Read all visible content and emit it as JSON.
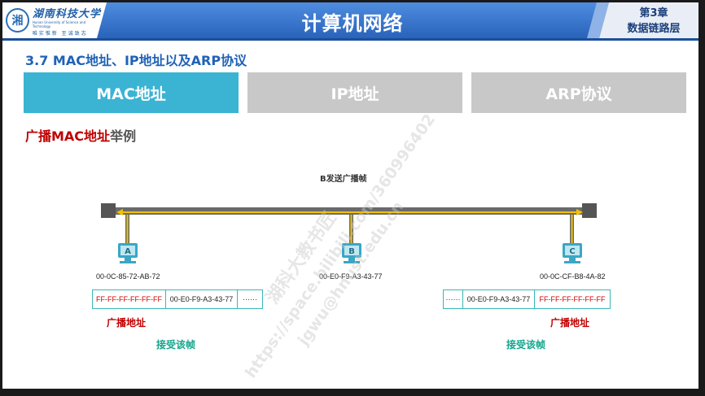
{
  "header": {
    "logo_name": "湖南科技大学",
    "logo_english": "Hunan University of Science and Technology",
    "logo_motto": "唯实惟新 至诚致志",
    "title": "计算机网络",
    "chapter_line1": "第3章",
    "chapter_line2": "数据链路层"
  },
  "section_title": "3.7 MAC地址、IP地址以及ARP协议",
  "tabs": [
    {
      "label": "MAC地址",
      "active": true
    },
    {
      "label": "IP地址",
      "active": false
    },
    {
      "label": "ARP协议",
      "active": false
    }
  ],
  "subheading": {
    "red": "广播MAC地址",
    "gray": "举例"
  },
  "diagram": {
    "caption": "B发送广播帧",
    "hosts": [
      {
        "letter": "A",
        "mac": "00-0C-85-72-AB-72"
      },
      {
        "letter": "B",
        "mac": "00-E0-F9-A3-43-77"
      },
      {
        "letter": "C",
        "mac": "00-0C-CF-B8-4A-82"
      }
    ],
    "frame_left": {
      "dest": "FF-FF-FF-FF-FF-FF",
      "src": "00-E0-F9-A3-43-77",
      "rest": "······"
    },
    "frame_right": {
      "rest": "······",
      "src": "00-E0-F9-A3-43-77",
      "dest": "FF-FF-FF-FF-FF-FF"
    },
    "label_broadcast": "广播地址",
    "label_accept": "接受该帧"
  },
  "watermark": {
    "line1": "湖科大教书匠",
    "line2": "https://space.bilibili.com/360996402",
    "line3": "jgwu@hnust.edu.cn"
  },
  "colors": {
    "tab_active": "#3bb3d3",
    "tab_inactive": "#c8c8c8",
    "header_blue": "#2f6fc4",
    "accent_red": "#c00000",
    "accent_green": "#14a58c"
  }
}
